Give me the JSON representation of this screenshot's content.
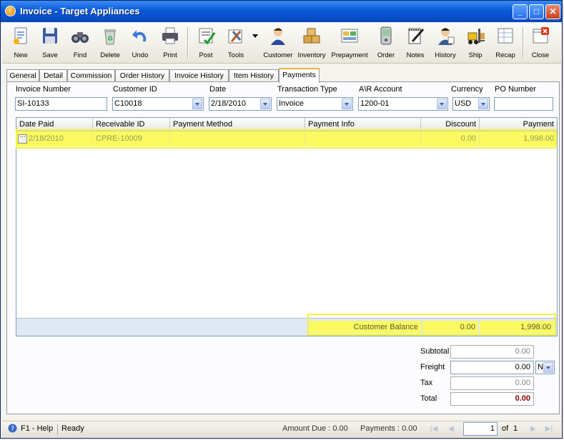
{
  "window": {
    "title": "Invoice - Target Appliances"
  },
  "toolbar": {
    "buttons": [
      {
        "label": "New",
        "icon": "new-doc-icon"
      },
      {
        "label": "Save",
        "icon": "floppy-icon"
      },
      {
        "label": "Find",
        "icon": "binoculars-icon"
      },
      {
        "label": "Delete",
        "icon": "recycle-bin-icon"
      },
      {
        "label": "Undo",
        "icon": "undo-arrow-icon"
      },
      {
        "label": "Print",
        "icon": "printer-icon"
      },
      {
        "label": "Post",
        "icon": "post-check-icon"
      },
      {
        "label": "Tools",
        "icon": "tools-icon"
      },
      {
        "label": "Customer",
        "icon": "customer-person-icon"
      },
      {
        "label": "Inventory",
        "icon": "boxes-icon"
      },
      {
        "label": "Prepayment",
        "icon": "prepayment-icon"
      },
      {
        "label": "Order",
        "icon": "pda-icon"
      },
      {
        "label": "Notes",
        "icon": "notepad-icon"
      },
      {
        "label": "History",
        "icon": "history-person-icon"
      },
      {
        "label": "Ship",
        "icon": "forklift-icon"
      },
      {
        "label": "Recap",
        "icon": "recap-sheet-icon"
      },
      {
        "label": "Close",
        "icon": "close-doc-icon"
      }
    ]
  },
  "tabs": [
    "General",
    "Detail",
    "Commission",
    "Order History",
    "Invoice History",
    "Item History",
    "Payments"
  ],
  "active_tab": "Payments",
  "header": {
    "invoice_number_label": "Invoice Number",
    "invoice_number": "SI-10133",
    "customer_id_label": "Customer ID",
    "customer_id": "C10018",
    "date_label": "Date",
    "date": "2/18/2010",
    "transaction_type_label": "Transaction Type",
    "transaction_type": "Invoice",
    "ar_account_label": "A\\R Account",
    "ar_account": "1200-01",
    "currency_label": "Currency",
    "currency": "USD",
    "po_number_label": "PO Number",
    "po_number": ""
  },
  "payments_grid": {
    "columns": [
      "Date Paid",
      "Receivable ID",
      "Payment Method",
      "Payment Info",
      "Discount",
      "Payment"
    ],
    "rows": [
      {
        "date_paid": "2/18/2010",
        "receivable_id": "CPRE-10009",
        "payment_method": "",
        "payment_info": "",
        "discount": "0.00",
        "payment": "1,998.00"
      }
    ],
    "footer": {
      "label": "Customer Balance",
      "discount": "0.00",
      "payment": "1,998.00"
    }
  },
  "totals": {
    "subtotal_label": "Subtotal",
    "subtotal": "0.00",
    "freight_label": "Freight",
    "freight": "0.00",
    "freight_option": "N",
    "tax_label": "Tax",
    "tax": "0.00",
    "total_label": "Total",
    "total": "0.00"
  },
  "status": {
    "help": "F1 - Help",
    "state": "Ready",
    "amount_due": "Amount Due : 0.00",
    "payments": "Payments : 0.00",
    "page": "1",
    "of_label": "of",
    "page_count": "1"
  },
  "colors": {
    "highlight": "#fafa60",
    "titlebar": "#0a5ad8",
    "total_red": "#8b0000"
  }
}
